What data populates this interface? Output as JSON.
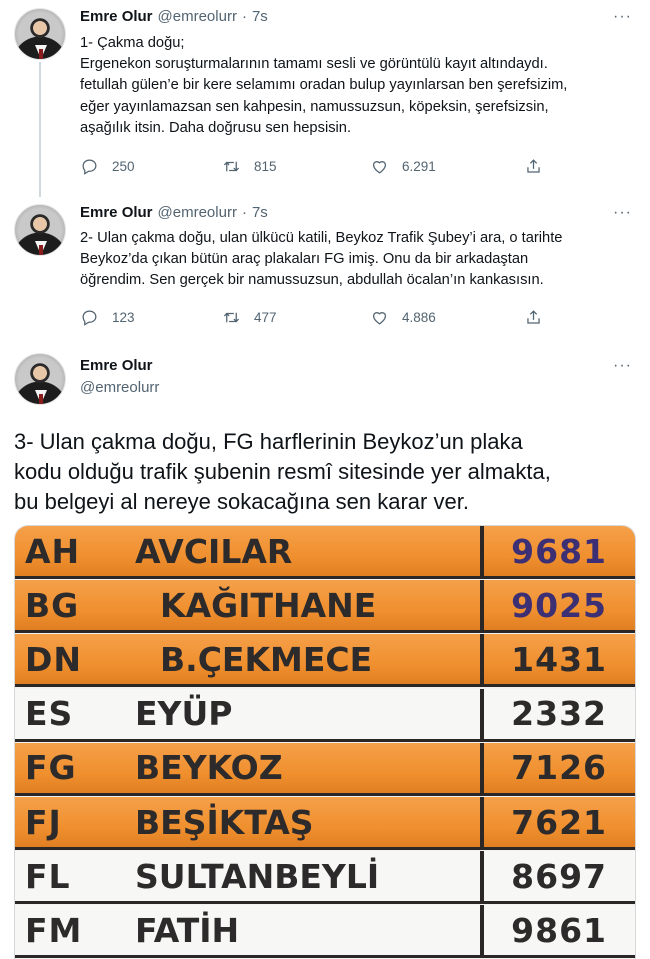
{
  "tweets": [
    {
      "name": "Emre Olur",
      "handle": "@emreolurr",
      "dot": "·",
      "time": "7s",
      "more": "···",
      "lines": [
        "1- Çakma doğu;",
        "Ergenekon soruşturmalarının tamamı sesli ve görüntülü kayıt altındaydı.",
        "fetullah gülen’e bir kere selamımı oradan bulup yayınlarsan ben şerefsizim,",
        "eğer yayınlamazsan sen kahpesin, namussuzsun, köpeksin, şerefsizsin,",
        "aşağılık itsin. Daha doğrusu sen hepsisin."
      ],
      "replies": "250",
      "retweets": "815",
      "likes": "6.291"
    },
    {
      "name": "Emre Olur",
      "handle": "@emreolurr",
      "dot": "·",
      "time": "7s",
      "more": "···",
      "lines": [
        "2- Ulan çakma doğu, ulan ülkücü katili, Beykoz Trafik Şubey’i ara, o tarihte",
        "Beykoz’da çıkan bütün araç plakaları FG imiş. Onu da bir arkadaştan",
        "öğrendim. Sen gerçek bir namussuzsun, abdullah öcalan’ın kankasısın."
      ],
      "replies": "123",
      "retweets": "477",
      "likes": "4.886"
    },
    {
      "name": "Emre Olur",
      "handle": "@emreolurr",
      "more": "···",
      "lines": [
        "3- Ulan çakma doğu, FG harflerinin Beykoz’un plaka",
        "kodu olduğu trafik şubenin resmî sitesinde yer almakta,",
        "bu belgeyi al nereye sokacağına sen karar ver."
      ]
    }
  ],
  "media_table": {
    "rows": [
      {
        "code": "AH",
        "district": "AVCILAR",
        "number": "9681",
        "highlight": true
      },
      {
        "code": "BG",
        "district": "KAĞITHANE",
        "number": "9025",
        "highlight": true
      },
      {
        "code": "DN",
        "district": "B.ÇEKMECE",
        "number": "1431",
        "highlight": true
      },
      {
        "code": "ES",
        "district": "EYÜP",
        "number": "2332",
        "highlight": false
      },
      {
        "code": "FG",
        "district": "BEYKOZ",
        "number": "7126",
        "highlight": true
      },
      {
        "code": "FJ",
        "district": "BEŞİKTAŞ",
        "number": "7621",
        "highlight": true
      },
      {
        "code": "FL",
        "district": "SULTANBEYLİ",
        "number": "8697",
        "highlight": false
      },
      {
        "code": "FM",
        "district": "FATİH",
        "number": "9861",
        "highlight": false
      }
    ],
    "colors": {
      "highlight": "#f0902f",
      "plain": "#f7f7f5",
      "number_purple": "#3c2f74"
    }
  }
}
